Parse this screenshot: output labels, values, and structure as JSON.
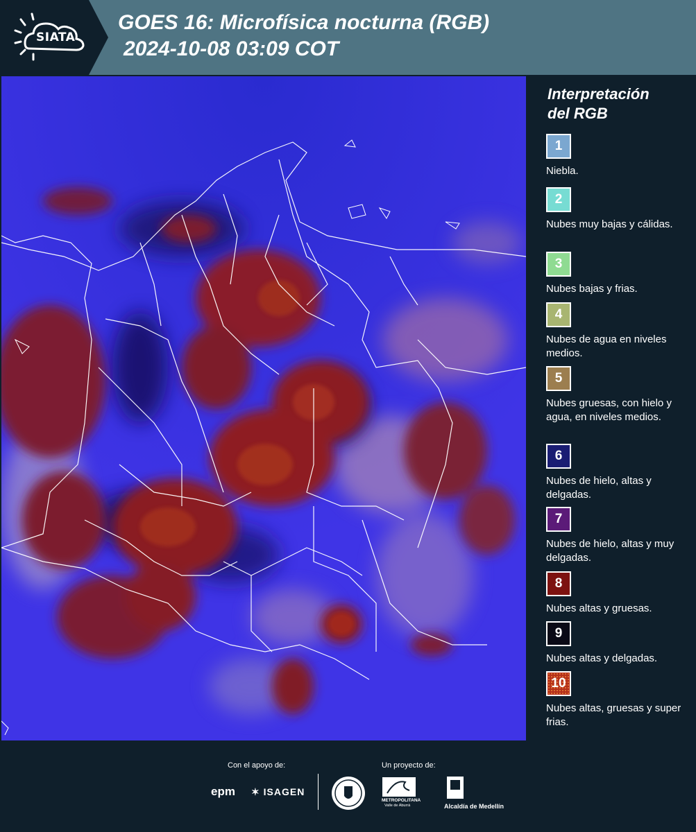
{
  "header": {
    "logo_text": "SIATA",
    "title": "GOES 16: Microfísica nocturna (RGB)",
    "subtitle": "2024-10-08 03:09 COT"
  },
  "legend": {
    "title_line1": "Interpretación",
    "title_line2": "del RGB",
    "items": [
      {
        "number": "1",
        "color": "#7ba7d0",
        "description": "Niebla."
      },
      {
        "number": "2",
        "color": "#77dcd3",
        "description": "Nubes muy bajas y cálidas."
      },
      {
        "number": "3",
        "color": "#8fdb92",
        "description": "Nubes bajas y frias."
      },
      {
        "number": "4",
        "color": "#a8b571",
        "description": "Nubes de agua en niveles medios."
      },
      {
        "number": "5",
        "color": "#9c7e4f",
        "description": "Nubes gruesas, con hielo y agua, en niveles medios."
      },
      {
        "number": "6",
        "color": "#1a1d73",
        "description": "Nubes de hielo, altas y delgadas."
      },
      {
        "number": "7",
        "color": "#5b1b78",
        "description": "Nubes de hielo, altas y muy delgadas."
      },
      {
        "number": "8",
        "color": "#7d1210",
        "description": "Nubes altas y gruesas."
      },
      {
        "number": "9",
        "color": "#0a0a16",
        "description": "Nubes altas y delgadas."
      },
      {
        "number": "10",
        "color": "#b5301b",
        "description": "Nubes altas, gruesas y super frias."
      }
    ]
  },
  "footer": {
    "support_label": "Con el apoyo de:",
    "project_label": "Un proyecto de:",
    "sponsor_epm": "epm",
    "sponsor_isagen": "ISAGEN",
    "area_label": "METROPOLITANA",
    "area_sub": "Valle de Aburrá",
    "alcaldia_label": "Alcaldía de Medellín"
  }
}
